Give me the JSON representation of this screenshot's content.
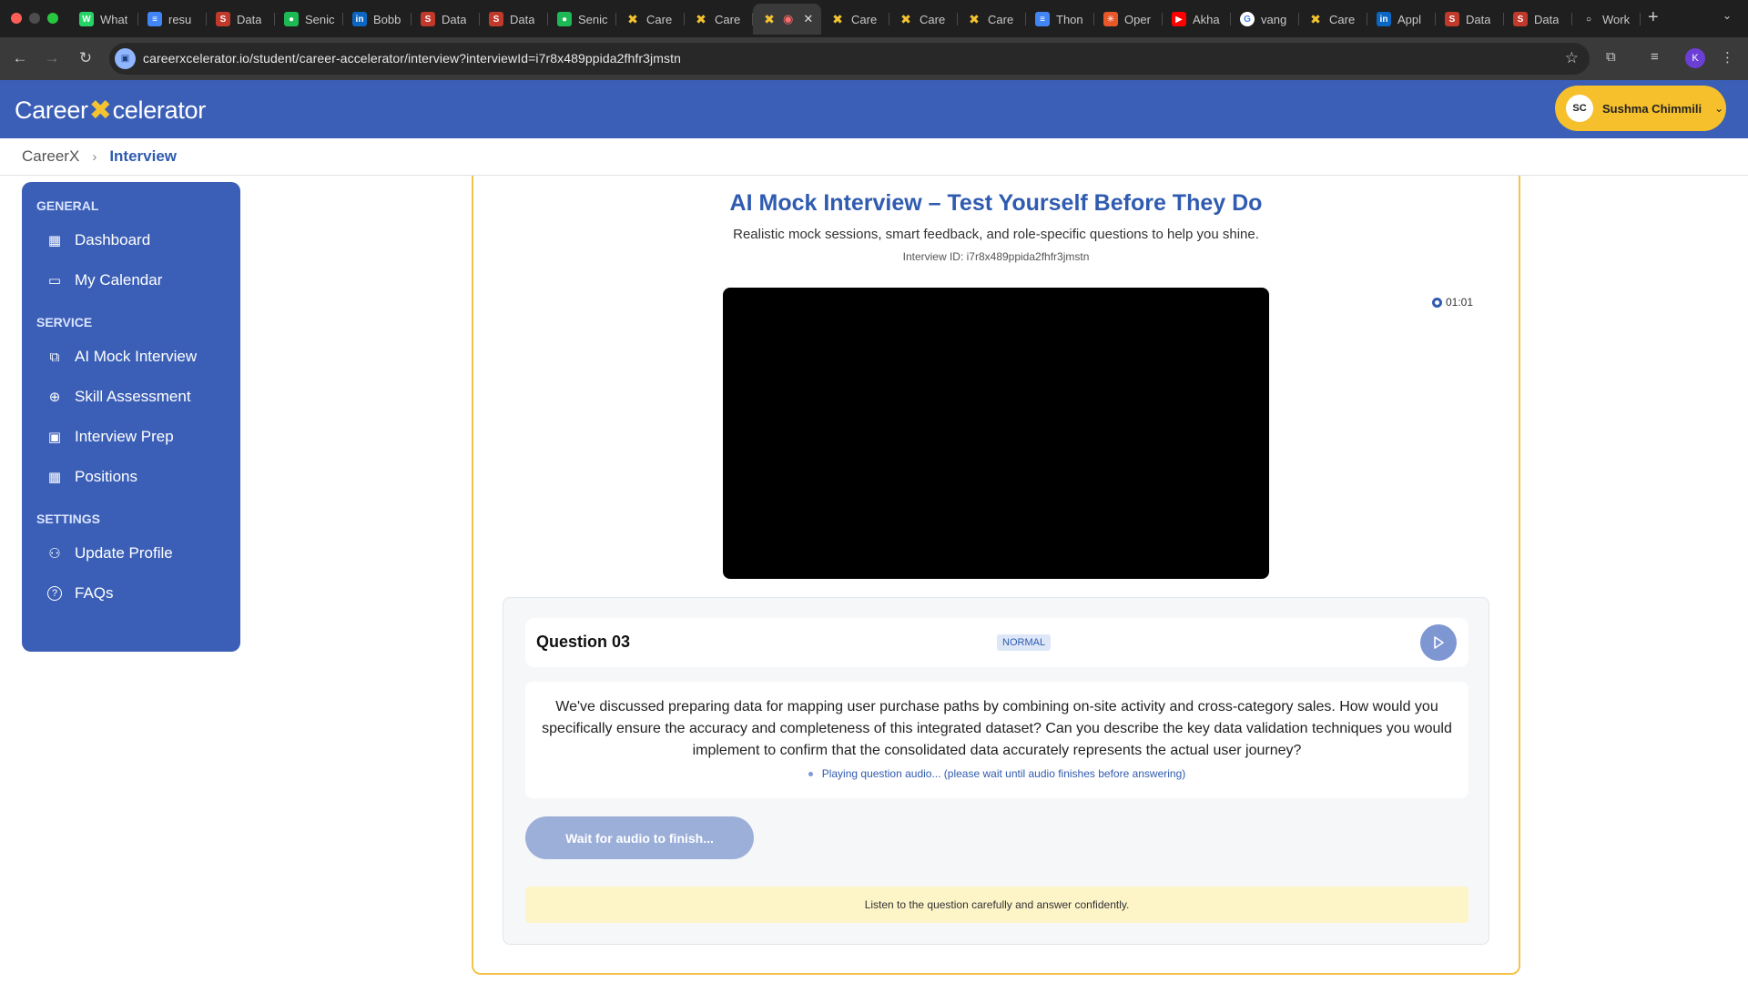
{
  "browser": {
    "tabs": [
      {
        "title": "What",
        "favicon_color": "#25d366",
        "favicon_glyph": "W"
      },
      {
        "title": "resu",
        "favicon_color": "#4285f4",
        "favicon_glyph": "≡"
      },
      {
        "title": "Data",
        "favicon_color": "#c0392b",
        "favicon_glyph": "S"
      },
      {
        "title": "Senic",
        "favicon_color": "#1db954",
        "favicon_glyph": "●"
      },
      {
        "title": "Bobb",
        "favicon_color": "#0a66c2",
        "favicon_glyph": "in"
      },
      {
        "title": "Data",
        "favicon_color": "#c0392b",
        "favicon_glyph": "S"
      },
      {
        "title": "Data",
        "favicon_color": "#c0392b",
        "favicon_glyph": "S"
      },
      {
        "title": "Senic",
        "favicon_color": "#1db954",
        "favicon_glyph": "●"
      },
      {
        "title": "Care",
        "favicon_color": "#f4c430",
        "favicon_glyph": "✖"
      },
      {
        "title": "Care",
        "favicon_color": "#f4c430",
        "favicon_glyph": "✖"
      },
      {
        "title": "",
        "favicon_color": "#f4c430",
        "favicon_glyph": "✖",
        "active": true
      },
      {
        "title": "Care",
        "favicon_color": "#f4c430",
        "favicon_glyph": "✖"
      },
      {
        "title": "Care",
        "favicon_color": "#f4c430",
        "favicon_glyph": "✖"
      },
      {
        "title": "Care",
        "favicon_color": "#f4c430",
        "favicon_glyph": "✖"
      },
      {
        "title": "Thon",
        "favicon_color": "#4285f4",
        "favicon_glyph": "≡"
      },
      {
        "title": "Oper",
        "favicon_color": "#e8572a",
        "favicon_glyph": "✳"
      },
      {
        "title": "Akha",
        "favicon_color": "#ff0000",
        "favicon_glyph": "▶"
      },
      {
        "title": "vang",
        "favicon_color": "#ffffff",
        "favicon_glyph": "G"
      },
      {
        "title": "Care",
        "favicon_color": "#f4c430",
        "favicon_glyph": "✖"
      },
      {
        "title": "Appl",
        "favicon_color": "#0a66c2",
        "favicon_glyph": "in"
      },
      {
        "title": "Data",
        "favicon_color": "#c0392b",
        "favicon_glyph": "S"
      },
      {
        "title": "Data",
        "favicon_color": "#c0392b",
        "favicon_glyph": "S"
      },
      {
        "title": "Work",
        "favicon_color": "#1f1f1f",
        "favicon_glyph": "○"
      }
    ],
    "url": "careerxcelerator.io/student/career-accelerator/interview?interviewId=i7r8x489ppida2fhfr3jmstn",
    "profile_initial": "K"
  },
  "app": {
    "logo_left": "Career",
    "logo_right": "celerator",
    "brand_color": "#3b5fb6",
    "accent_color": "#f6c02c",
    "user": {
      "initials": "SC",
      "name": "Sushma Chimmili"
    }
  },
  "breadcrumb": {
    "root": "CareerX",
    "current": "Interview"
  },
  "sidebar": {
    "sections": [
      {
        "label": "GENERAL",
        "items": [
          {
            "label": "Dashboard",
            "icon": "grid-icon"
          },
          {
            "label": "My Calendar",
            "icon": "calendar-icon"
          }
        ]
      },
      {
        "label": "SERVICE",
        "items": [
          {
            "label": "AI Mock Interview",
            "icon": "video-chat-icon"
          },
          {
            "label": "Skill Assessment",
            "icon": "globe-icon"
          },
          {
            "label": "Interview Prep",
            "icon": "briefcase-icon"
          },
          {
            "label": "Positions",
            "icon": "grid-icon"
          }
        ]
      },
      {
        "label": "SETTINGS",
        "items": [
          {
            "label": "Update Profile",
            "icon": "user-icon"
          },
          {
            "label": "FAQs",
            "icon": "help-circle-icon"
          }
        ]
      }
    ]
  },
  "interview": {
    "title": "AI Mock Interview – Test Yourself Before They Do",
    "subtitle": "Realistic mock sessions, smart feedback, and role-specific questions to help you shine.",
    "id_label": "Interview ID: i7r8x489ppida2fhfr3jmstn",
    "timer": "01:01",
    "question_label": "Question 03",
    "badge": "NORMAL",
    "question_text": "We've discussed preparing data for mapping user purchase paths by combining on-site activity and cross-category sales. How would you specifically ensure the accuracy and completeness of this integrated dataset? Can you describe the key data validation techniques you would implement to confirm that the consolidated data accurately represents the actual user journey?",
    "status": "Playing question audio... (please wait until audio finishes before answering)",
    "wait_button": "Wait for audio to finish...",
    "tip": "Listen to the question carefully and answer confidently."
  }
}
